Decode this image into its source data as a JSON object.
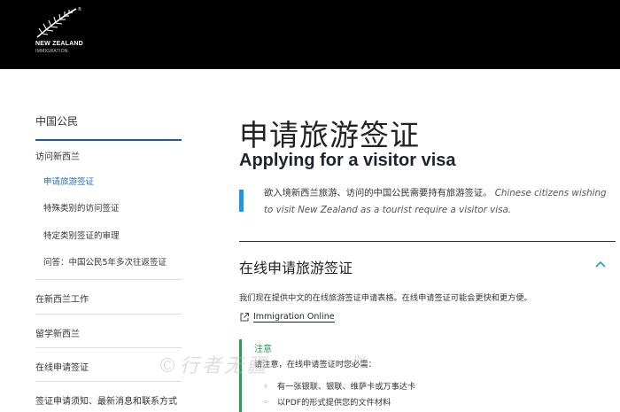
{
  "header": {
    "logo_title": "NEW ZEALAND",
    "logo_subtitle": "IMMIGRATION",
    "logo_reg": "®",
    "background": "#000000"
  },
  "sidebar": {
    "heading": "中国公民",
    "sections": [
      {
        "label": "访问新西兰",
        "items": [
          {
            "label": "申请旅游签证",
            "active": true
          },
          {
            "label": "特殊类别的访问签证",
            "active": false
          },
          {
            "label": "特定类别签证的审理",
            "active": false
          },
          {
            "label": "问答：中国公民5年多次往返签证",
            "active": false
          }
        ]
      },
      {
        "label": "在新西兰工作"
      },
      {
        "label": "留学新西兰"
      },
      {
        "label": "在线申请签证"
      },
      {
        "label": "签证申请须知、最新消息和联系方式"
      }
    ],
    "accent_color": "#1f5aa8"
  },
  "main": {
    "title_zh": "申请旅游签证",
    "title_en": "Applying for a visitor visa",
    "intro_zh": "欲入境新西兰旅游、访问的中国公民需要持有旅游签证。",
    "intro_en": "Chinese citizens wishing to visit New Zealand as a tourist require a visitor visa.",
    "section": {
      "title": "在线申请旅游签证",
      "text": "我们现在提供中文的在线旅游签证申请表格。在线申请签证可能会更快和更方便。",
      "link_label": "Immigration Online",
      "note": {
        "title": "注意",
        "text": "请注意，在线申请签证时您必需：",
        "items": [
          "有一张银联、银联、维萨卡或万事达卡",
          "以PDF的形式提供您的文件材料"
        ]
      }
    },
    "intro_bar_color": "#1f9ad8",
    "note_color": "#2a9d57"
  },
  "watermark": {
    "text": "©行者无疆",
    "suffix": "Ily"
  }
}
